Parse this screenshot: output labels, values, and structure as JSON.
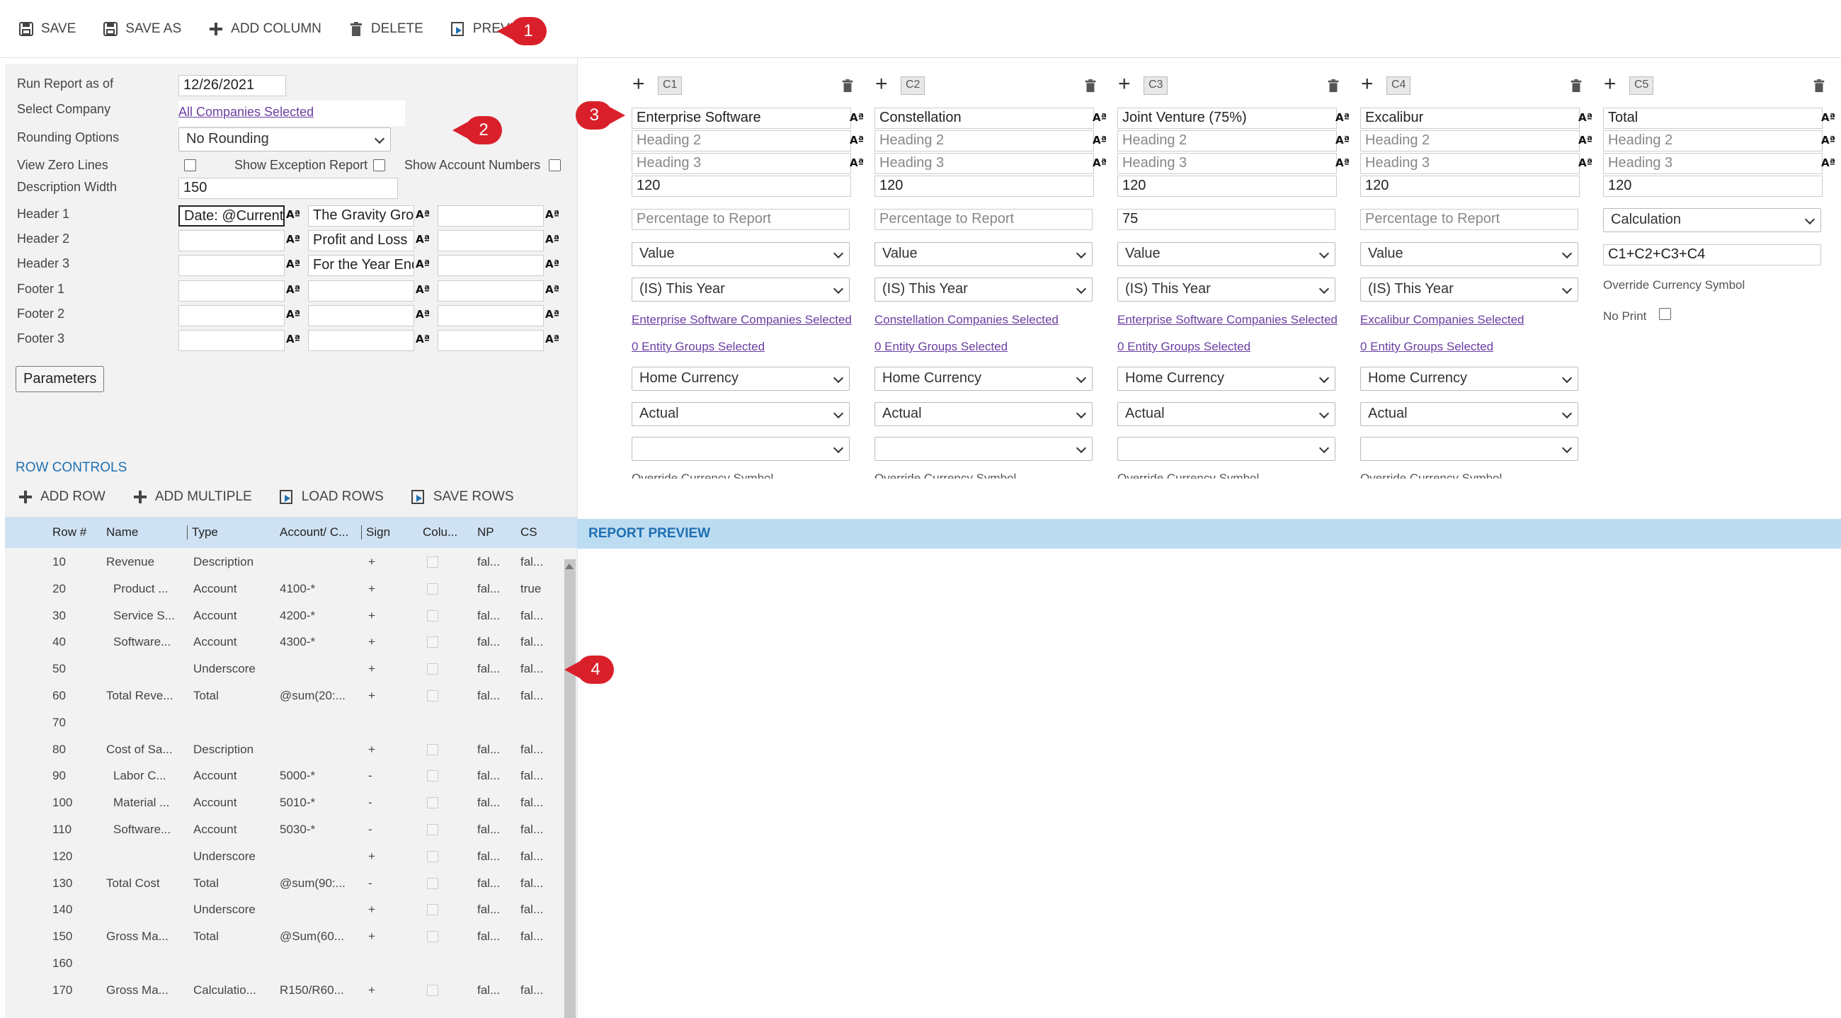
{
  "toolbar": {
    "save": "SAVE",
    "save_as": "SAVE AS",
    "add_column": "ADD COLUMN",
    "delete": "DELETE",
    "preview": "PREVIEW"
  },
  "markers": [
    "1",
    "2",
    "3",
    "4"
  ],
  "params": {
    "run_report_label": "Run Report as of",
    "run_report_value": "12/26/2021",
    "select_company_label": "Select Company",
    "select_company_link": "All Companies Selected",
    "rounding_label": "Rounding Options",
    "rounding_value": "No Rounding",
    "zero_lines_label": "View Zero Lines",
    "exception_label": "Show Exception Report",
    "account_numbers_label": "Show Account Numbers",
    "desc_width_label": "Description Width",
    "desc_width_value": "150",
    "header1_label": "Header 1",
    "header2_label": "Header 2",
    "header3_label": "Header 3",
    "footer1_label": "Footer 1",
    "footer2_label": "Footer 2",
    "footer3_label": "Footer 3",
    "header1_a": "Date: @CurrentDate",
    "header1_b": "The Gravity Group",
    "header2_b": "Profit and Loss",
    "header3_b": "For the Year Ending",
    "parameters_button": "Parameters"
  },
  "row_controls": {
    "title": "ROW CONTROLS",
    "add_row": "ADD ROW",
    "add_multiple": "ADD MULTIPLE",
    "load_rows": "LOAD ROWS",
    "save_rows": "SAVE ROWS"
  },
  "grid": {
    "headers": [
      "Row #",
      "Name",
      "Type",
      "Account/ C...",
      "Sign",
      "Colu...",
      "NP",
      "CS"
    ],
    "rows": [
      {
        "num": "10",
        "name": "Revenue",
        "type": "Description",
        "acct": "",
        "sign": "+",
        "np": "fal...",
        "cs": "fal..."
      },
      {
        "num": "20",
        "name": "Product ...",
        "type": "Account",
        "acct": "4100-*",
        "sign": "+",
        "np": "fal...",
        "cs": "true"
      },
      {
        "num": "30",
        "name": "Service S...",
        "type": "Account",
        "acct": "4200-*",
        "sign": "+",
        "np": "fal...",
        "cs": "fal..."
      },
      {
        "num": "40",
        "name": "Software...",
        "type": "Account",
        "acct": "4300-*",
        "sign": "+",
        "np": "fal...",
        "cs": "fal..."
      },
      {
        "num": "50",
        "name": "",
        "type": "Underscore",
        "acct": "",
        "sign": "+",
        "np": "fal...",
        "cs": "fal..."
      },
      {
        "num": "60",
        "name": "Total Reve...",
        "type": "Total",
        "acct": "@sum(20:...",
        "sign": "+",
        "np": "fal...",
        "cs": "fal..."
      },
      {
        "num": "70",
        "name": "",
        "type": "",
        "acct": "",
        "sign": "",
        "np": "",
        "cs": ""
      },
      {
        "num": "80",
        "name": "Cost of Sa...",
        "type": "Description",
        "acct": "",
        "sign": "+",
        "np": "fal...",
        "cs": "fal..."
      },
      {
        "num": "90",
        "name": "Labor C...",
        "type": "Account",
        "acct": "5000-*",
        "sign": "-",
        "np": "fal...",
        "cs": "fal..."
      },
      {
        "num": "100",
        "name": "Material ...",
        "type": "Account",
        "acct": "5010-*",
        "sign": "-",
        "np": "fal...",
        "cs": "fal..."
      },
      {
        "num": "110",
        "name": "Software...",
        "type": "Account",
        "acct": "5030-*",
        "sign": "-",
        "np": "fal...",
        "cs": "fal..."
      },
      {
        "num": "120",
        "name": "",
        "type": "Underscore",
        "acct": "",
        "sign": "+",
        "np": "fal...",
        "cs": "fal..."
      },
      {
        "num": "130",
        "name": "Total Cost",
        "type": "Total",
        "acct": "@sum(90:...",
        "sign": "-",
        "np": "fal...",
        "cs": "fal..."
      },
      {
        "num": "140",
        "name": "",
        "type": "Underscore",
        "acct": "",
        "sign": "+",
        "np": "fal...",
        "cs": "fal..."
      },
      {
        "num": "150",
        "name": "Gross Ma...",
        "type": "Total",
        "acct": "@Sum(60...",
        "sign": "+",
        "np": "fal...",
        "cs": "fal..."
      },
      {
        "num": "160",
        "name": "",
        "type": "",
        "acct": "",
        "sign": "",
        "np": "",
        "cs": ""
      },
      {
        "num": "170",
        "name": "Gross Ma...",
        "type": "Calculatio...",
        "acct": "R150/R60...",
        "sign": "+",
        "np": "fal...",
        "cs": "fal..."
      }
    ]
  },
  "columns": [
    {
      "id": "C1",
      "heading1": "Enterprise Software",
      "heading2": "Heading 2",
      "heading3": "Heading 3",
      "width": "120",
      "pct": "Percentage to Report",
      "value_type": "Value",
      "period": "(IS) This Year",
      "companies": "Enterprise Software Companies Selected",
      "groups": "0 Entity Groups Selected",
      "currency": "Home Currency",
      "scenario": "Actual",
      "override": "Override Currency Symbol"
    },
    {
      "id": "C2",
      "heading1": "Constellation",
      "heading2": "Heading 2",
      "heading3": "Heading 3",
      "width": "120",
      "pct": "Percentage to Report",
      "value_type": "Value",
      "period": "(IS) This Year",
      "companies": "Constellation Companies Selected",
      "groups": "0 Entity Groups Selected",
      "currency": "Home Currency",
      "scenario": "Actual",
      "override": "Override Currency Symbol"
    },
    {
      "id": "C3",
      "heading1": "Joint Venture (75%)",
      "heading2": "Heading 2",
      "heading3": "Heading 3",
      "width": "120",
      "pct": "75",
      "value_type": "Value",
      "period": "(IS) This Year",
      "companies": "Enterprise Software Companies Selected",
      "groups": "0 Entity Groups Selected",
      "currency": "Home Currency",
      "scenario": "Actual",
      "override": "Override Currency Symbol"
    },
    {
      "id": "C4",
      "heading1": "Excalibur",
      "heading2": "Heading 2",
      "heading3": "Heading 3",
      "width": "120",
      "pct": "Percentage to Report",
      "value_type": "Value",
      "period": "(IS) This Year",
      "companies": "Excalibur Companies Selected",
      "groups": "0 Entity Groups Selected",
      "currency": "Home Currency",
      "scenario": "Actual",
      "override": "Override Currency Symbol"
    }
  ],
  "col5": {
    "id": "C5",
    "heading1": "Total",
    "heading2": "Heading 2",
    "heading3": "Heading 3",
    "width": "120",
    "calc_type": "Calculation",
    "formula": "C1+C2+C3+C4",
    "override": "Override Currency Symbol",
    "no_print": "No Print"
  },
  "report_preview": {
    "title": "REPORT PREVIEW"
  }
}
